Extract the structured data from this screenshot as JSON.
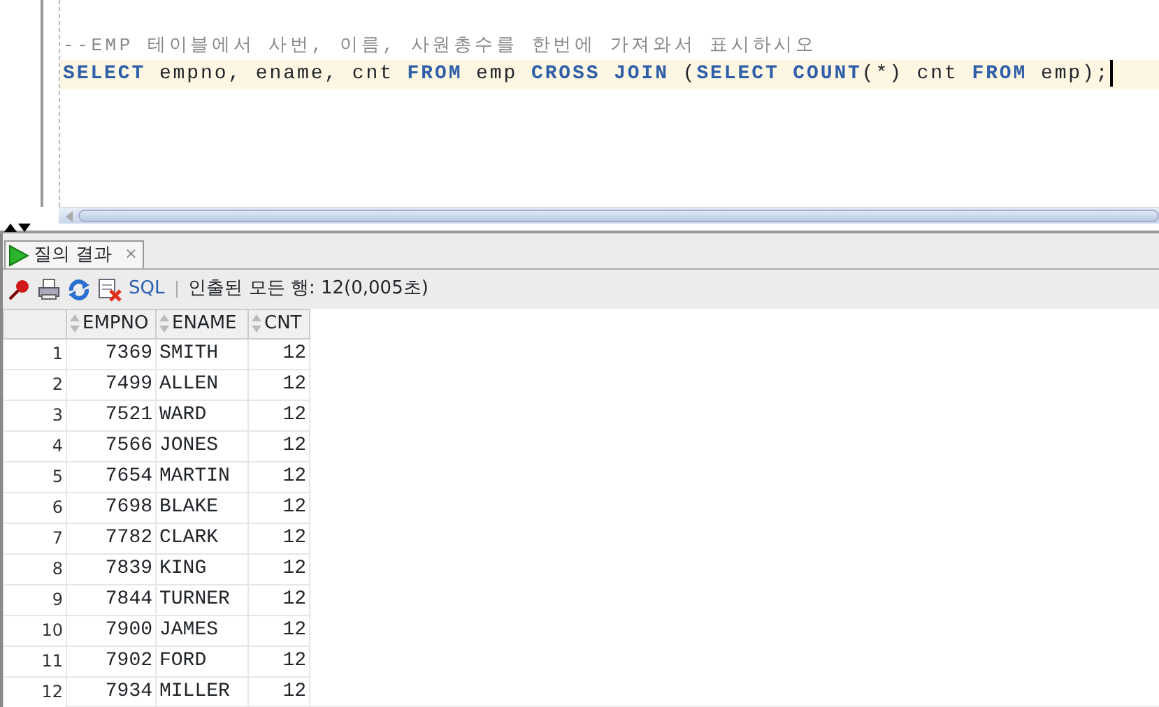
{
  "editor": {
    "comment": "--EMP 테이블에서 사번, 이름, 사원총수를 한번에 가져와서 표시하시오",
    "sql_tokens": [
      {
        "text": "SELECT",
        "kind": "keyword"
      },
      {
        "text": " empno, ename, cnt ",
        "kind": "plain"
      },
      {
        "text": "FROM",
        "kind": "keyword"
      },
      {
        "text": " emp ",
        "kind": "plain"
      },
      {
        "text": "CROSS JOIN",
        "kind": "keyword"
      },
      {
        "text": " (",
        "kind": "plain"
      },
      {
        "text": "SELECT COUNT",
        "kind": "keyword"
      },
      {
        "text": "(*) cnt ",
        "kind": "plain"
      },
      {
        "text": "FROM",
        "kind": "keyword"
      },
      {
        "text": " emp);",
        "kind": "plain"
      }
    ]
  },
  "results_tab": {
    "label": "질의 결과",
    "close": "×",
    "selected": true
  },
  "toolbar": {
    "sql_label": "SQL",
    "status": "인출된 모든 행: 12(0,005초)"
  },
  "table": {
    "columns": [
      "EMPNO",
      "ENAME",
      "CNT"
    ],
    "rows": [
      {
        "row_number": "1",
        "empno": "7369",
        "ename": "SMITH",
        "cnt": "12"
      },
      {
        "row_number": "2",
        "empno": "7499",
        "ename": "ALLEN",
        "cnt": "12"
      },
      {
        "row_number": "3",
        "empno": "7521",
        "ename": "WARD",
        "cnt": "12"
      },
      {
        "row_number": "4",
        "empno": "7566",
        "ename": "JONES",
        "cnt": "12"
      },
      {
        "row_number": "5",
        "empno": "7654",
        "ename": "MARTIN",
        "cnt": "12"
      },
      {
        "row_number": "6",
        "empno": "7698",
        "ename": "BLAKE",
        "cnt": "12"
      },
      {
        "row_number": "7",
        "empno": "7782",
        "ename": "CLARK",
        "cnt": "12"
      },
      {
        "row_number": "8",
        "empno": "7839",
        "ename": "KING",
        "cnt": "12"
      },
      {
        "row_number": "9",
        "empno": "7844",
        "ename": "TURNER",
        "cnt": "12"
      },
      {
        "row_number": "10",
        "empno": "7900",
        "ename": "JAMES",
        "cnt": "12"
      },
      {
        "row_number": "11",
        "empno": "7902",
        "ename": "FORD",
        "cnt": "12"
      },
      {
        "row_number": "12",
        "empno": "7934",
        "ename": "MILLER",
        "cnt": "12"
      }
    ]
  }
}
